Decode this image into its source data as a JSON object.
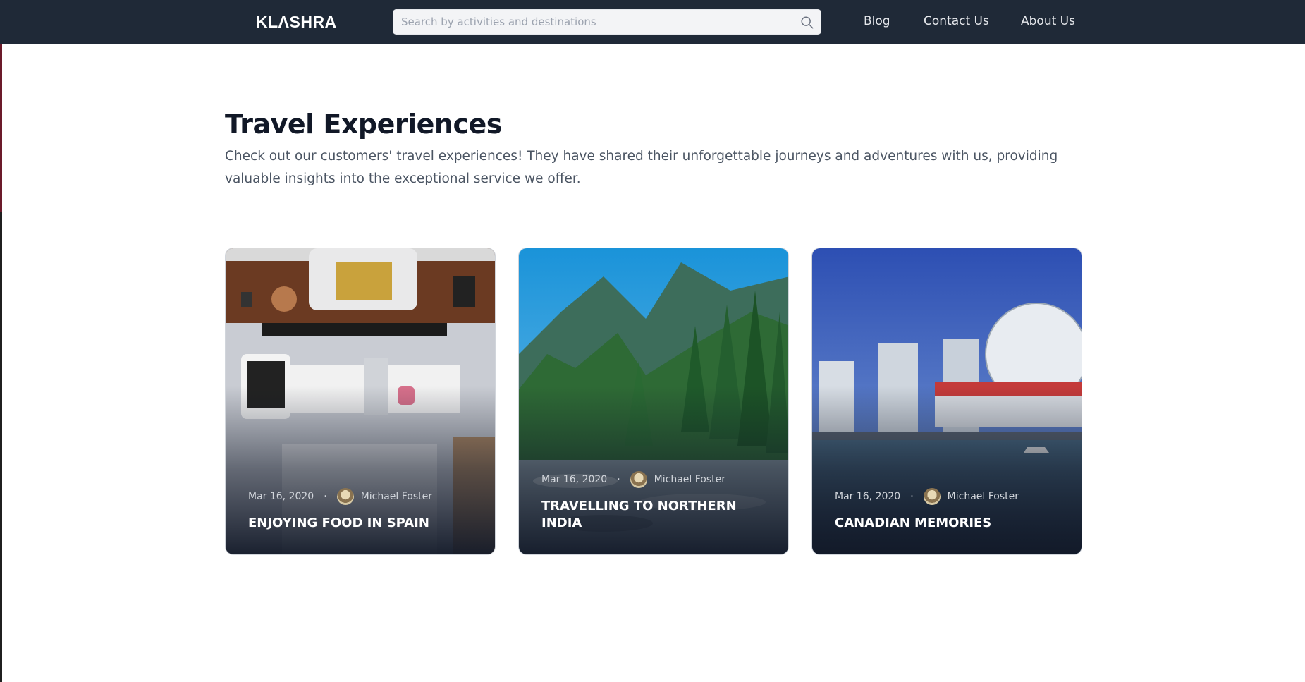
{
  "header": {
    "logo": "KLΛSHRA",
    "search": {
      "placeholder": "Search by activities and destinations",
      "value": ""
    },
    "nav": [
      {
        "label": "Blog"
      },
      {
        "label": "Contact Us"
      },
      {
        "label": "About Us"
      }
    ]
  },
  "main": {
    "title": "Travel Experiences",
    "description": "Check out our customers' travel experiences! They have shared their unforgettable journeys and adventures with us, providing valuable insights into the exceptional service we offer.",
    "cards": [
      {
        "date": "Mar 16, 2020",
        "separator": "·",
        "author": "Michael Foster",
        "title": "ENJOYING FOOD IN SPAIN"
      },
      {
        "date": "Mar 16, 2020",
        "separator": "·",
        "author": "Michael Foster",
        "title": "TRAVELLING TO NORTHERN INDIA"
      },
      {
        "date": "Mar 16, 2020",
        "separator": "·",
        "author": "Michael Foster",
        "title": "CANADIAN MEMORIES"
      }
    ]
  },
  "colors": {
    "header_bg": "#1f2937",
    "title_text": "#111827",
    "body_text": "#4b5563"
  }
}
